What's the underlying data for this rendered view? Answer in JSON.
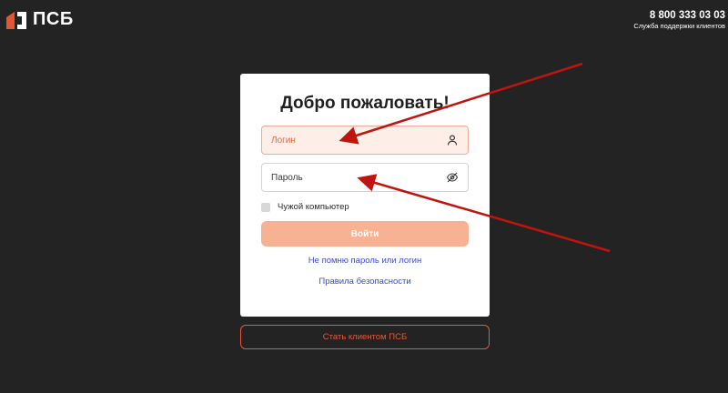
{
  "header": {
    "logo_text": "ПСБ",
    "logo_icon": "psb-logo-icon",
    "brand_color": "#e4562f"
  },
  "support": {
    "phone": "8 800 333 03 03",
    "label": "Служба поддержки клиентов"
  },
  "login_form": {
    "title": "Добро пожаловать!",
    "login_placeholder": "Логин",
    "login_icon": "user-icon",
    "password_placeholder": "Пароль",
    "password_icon": "eye-off-icon",
    "remember_label": "Чужой компьютер",
    "submit_label": "Войти",
    "forgot_link": "Не помню пароль или логин",
    "security_link": "Правила безопасности"
  },
  "become_client_label": "Стать клиентом ПСБ",
  "annotation": {
    "arrow_color": "#c0140e"
  }
}
